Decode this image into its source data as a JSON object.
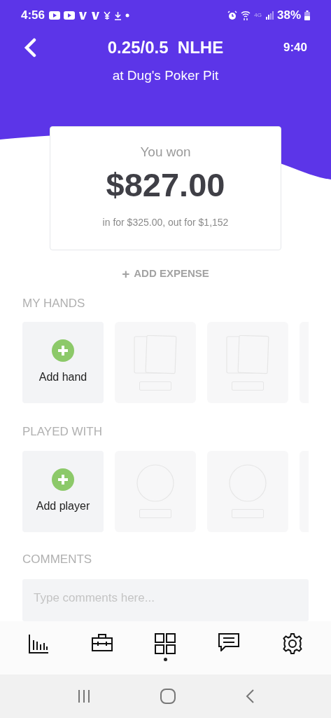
{
  "status_bar": {
    "time": "4:56",
    "network": "4G",
    "battery": "38%"
  },
  "header": {
    "title": "0.25/0.5  NLHE",
    "subtitle": "at Dug's Poker Pit",
    "duration": "9:40"
  },
  "result": {
    "label": "You won",
    "amount": "$827.00",
    "detail": "in for $325.00, out for $1,152"
  },
  "add_expense": {
    "icon": "+",
    "label": "ADD EXPENSE"
  },
  "sections": [
    {
      "kind": "hands",
      "title": "MY HANDS",
      "add_label": "Add hand"
    },
    {
      "kind": "players",
      "title": "PLAYED WITH",
      "add_label": "Add player"
    }
  ],
  "comments": {
    "title": "COMMENTS",
    "placeholder": "Type comments here..."
  },
  "bottom_nav": [
    {
      "kind": "stats",
      "selected": false
    },
    {
      "kind": "briefcase",
      "selected": false
    },
    {
      "kind": "grid",
      "selected": true
    },
    {
      "kind": "chat",
      "selected": false
    },
    {
      "kind": "settings",
      "selected": false
    }
  ]
}
